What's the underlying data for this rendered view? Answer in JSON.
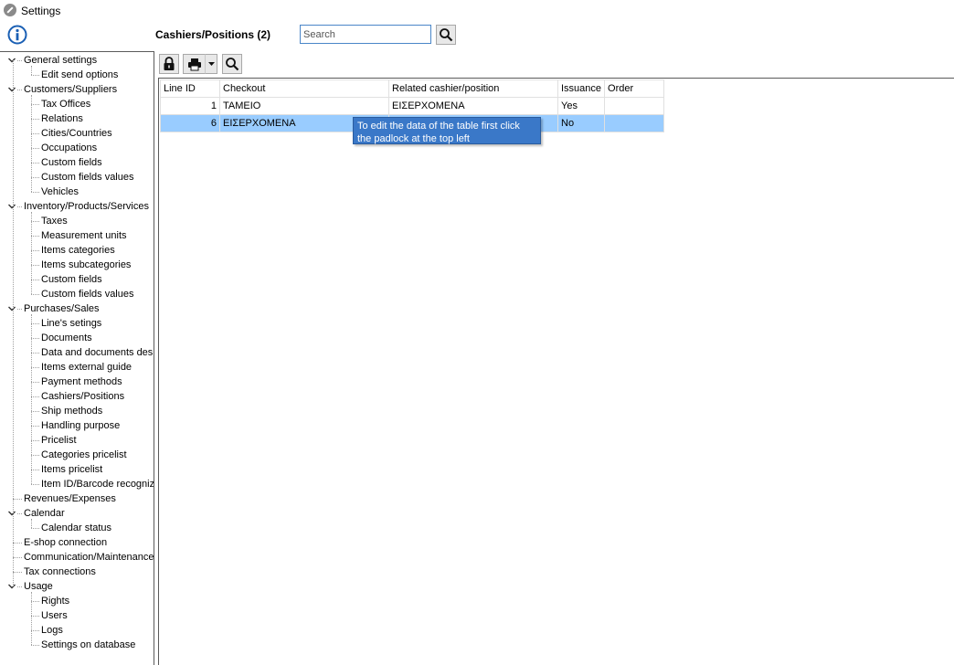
{
  "window": {
    "title": "Settings"
  },
  "tree": {
    "items": [
      {
        "label": "General settings",
        "level": 0,
        "expanded": true
      },
      {
        "label": "Edit send options",
        "level": 1
      },
      {
        "label": "Customers/Suppliers",
        "level": 0,
        "expanded": true
      },
      {
        "label": "Tax Offices",
        "level": 1
      },
      {
        "label": "Relations",
        "level": 1
      },
      {
        "label": "Cities/Countries",
        "level": 1
      },
      {
        "label": "Occupations",
        "level": 1
      },
      {
        "label": "Custom fields",
        "level": 1
      },
      {
        "label": "Custom fields values",
        "level": 1
      },
      {
        "label": "Vehicles",
        "level": 1
      },
      {
        "label": "Inventory/Products/Services",
        "level": 0,
        "expanded": true
      },
      {
        "label": "Taxes",
        "level": 1
      },
      {
        "label": "Measurement units",
        "level": 1
      },
      {
        "label": "Items categories",
        "level": 1
      },
      {
        "label": "Items subcategories",
        "level": 1
      },
      {
        "label": "Custom fields",
        "level": 1
      },
      {
        "label": "Custom fields values",
        "level": 1
      },
      {
        "label": "Purchases/Sales",
        "level": 0,
        "expanded": true
      },
      {
        "label": "Line's setings",
        "level": 1
      },
      {
        "label": "Documents",
        "level": 1
      },
      {
        "label": "Data and documents desi",
        "level": 1
      },
      {
        "label": "Items external guide",
        "level": 1
      },
      {
        "label": "Payment methods",
        "level": 1
      },
      {
        "label": "Cashiers/Positions",
        "level": 1
      },
      {
        "label": "Ship methods",
        "level": 1
      },
      {
        "label": "Handling purpose",
        "level": 1
      },
      {
        "label": "Pricelist",
        "level": 1
      },
      {
        "label": "Categories pricelist",
        "level": 1
      },
      {
        "label": "Items pricelist",
        "level": 1
      },
      {
        "label": "Item ID/Barcode recognize",
        "level": 1
      },
      {
        "label": "Revenues/Expenses",
        "level": 0
      },
      {
        "label": "Calendar",
        "level": 0,
        "expanded": true
      },
      {
        "label": "Calendar status",
        "level": 1
      },
      {
        "label": "E-shop connection",
        "level": 0
      },
      {
        "label": "Communication/Maintenance",
        "level": 0
      },
      {
        "label": "Tax connections",
        "level": 0
      },
      {
        "label": "Usage",
        "level": 0,
        "expanded": true
      },
      {
        "label": "Rights",
        "level": 1
      },
      {
        "label": "Users",
        "level": 1
      },
      {
        "label": "Logs",
        "level": 1
      },
      {
        "label": "Settings on database",
        "level": 1
      }
    ]
  },
  "main": {
    "title": "Cashiers/Positions (2)",
    "search": {
      "placeholder": "Search",
      "value": ""
    },
    "toolbar": {
      "lock_icon": "padlock-icon",
      "print_icon": "printer-icon",
      "find_icon": "magnifier-icon"
    },
    "table": {
      "columns": [
        "Line ID",
        "Checkout",
        "Related cashier/position",
        "Issuance",
        "Order"
      ],
      "rows": [
        {
          "line_id": "1",
          "checkout": "ΤΑΜΕΙΟ",
          "related": "ΕΙΣΕΡΧΟΜΕΝΑ",
          "issuance": "Yes",
          "order": "",
          "selected": false
        },
        {
          "line_id": "6",
          "checkout": "ΕΙΣΕΡΧΟΜΕΝΑ",
          "related": "",
          "issuance": "No",
          "order": "",
          "selected": true
        }
      ]
    },
    "tooltip": "To edit the data of the table first click the padlock at the top left"
  },
  "colors": {
    "selection": "#99ccff",
    "tooltip_bg": "#3a78c8",
    "info_icon": "#1a5fb4"
  }
}
